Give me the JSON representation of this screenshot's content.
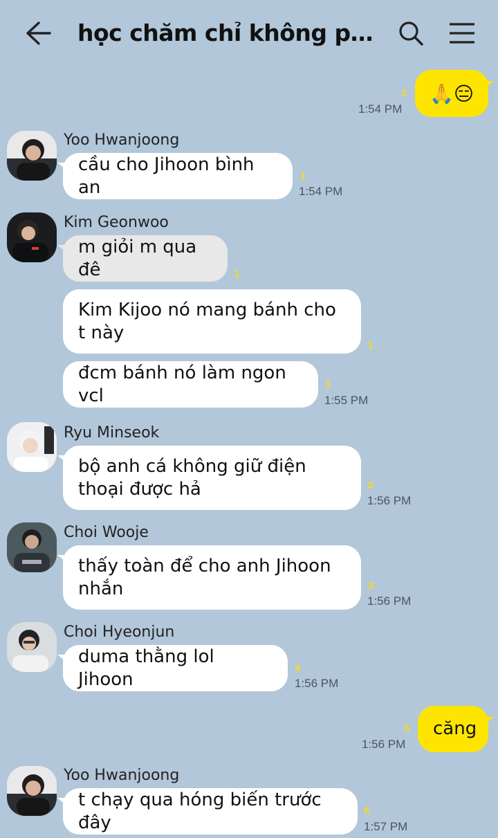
{
  "header": {
    "title": "học chăm chỉ không phải v...",
    "back_icon": "back-arrow-icon",
    "search_icon": "search-icon",
    "menu_icon": "menu-icon"
  },
  "messages": [
    {
      "id": "m0",
      "sender": "me",
      "text": "🙏😑",
      "unread": "1",
      "time": "1:54 PM"
    },
    {
      "id": "m1",
      "sender": "Yoo Hwanjoong",
      "text": "cầu cho Jihoon bình an",
      "unread": "1",
      "time": "1:54 PM"
    },
    {
      "id": "m2",
      "sender": "Kim Geonwoo",
      "text": "m giỏi m qua đê",
      "unread": "1",
      "time": ""
    },
    {
      "id": "m3",
      "sender": "Kim Geonwoo",
      "text": "Kim Kijoo nó mang bánh cho t này",
      "unread": "1",
      "time": ""
    },
    {
      "id": "m4",
      "sender": "Kim Geonwoo",
      "text": "đcm bánh nó làm ngon vcl",
      "unread": "1",
      "time": "1:55 PM"
    },
    {
      "id": "m5",
      "sender": "Ryu Minseok",
      "text": "bộ anh cá không giữ điện thoại được hả",
      "unread": "2",
      "time": "1:56 PM"
    },
    {
      "id": "m6",
      "sender": "Choi Wooje",
      "text": "thấy toàn để cho anh Jihoon nhắn",
      "unread": "3",
      "time": "1:56 PM"
    },
    {
      "id": "m7",
      "sender": "Choi Hyeonjun",
      "text": "duma thằng lol Jihoon",
      "unread": "4",
      "time": "1:56 PM"
    },
    {
      "id": "m8",
      "sender": "me",
      "text": "căng",
      "unread": "5",
      "time": "1:56 PM"
    },
    {
      "id": "m9",
      "sender": "Yoo Hwanjoong",
      "text": "t chạy qua hóng biến trước đây",
      "unread": "6",
      "time": "1:57 PM"
    }
  ],
  "colors": {
    "background": "#b2c7d9",
    "my_bubble": "#fee500",
    "other_bubble": "#ffffff",
    "unread": "#f2dc1c"
  }
}
